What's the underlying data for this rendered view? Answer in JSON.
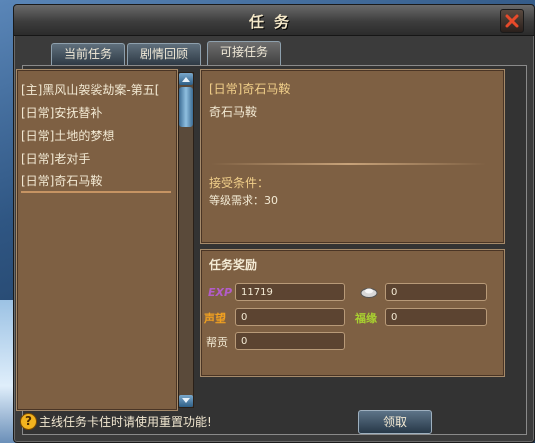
{
  "window": {
    "title": "任务"
  },
  "tabs": [
    {
      "label": "当前任务"
    },
    {
      "label": "剧情回顾"
    },
    {
      "label": "可接任务"
    }
  ],
  "quest_list": [
    {
      "label": "[主]黑风山袈裟劫案-第五["
    },
    {
      "label": "[日常]安抚替补"
    },
    {
      "label": "[日常]土地的梦想"
    },
    {
      "label": "[日常]老对手"
    },
    {
      "label": "[日常]奇石马鞍"
    }
  ],
  "detail": {
    "title": "[日常]奇石马鞍",
    "description": "奇石马鞍",
    "accept_header": "接受条件：",
    "requirement": "等级需求：30"
  },
  "rewards": {
    "header": "任务奖励",
    "exp_label": "EXP",
    "exp_value": "11719",
    "silver_value": "0",
    "prestige_label": "声望",
    "prestige_value": "0",
    "fortune_label": "福缘",
    "fortune_value": "0",
    "contribution_label": "帮贡",
    "contribution_value": "0"
  },
  "footer": {
    "hint": "主线任务卡住时请使用重置功能!",
    "claim_label": "领取"
  },
  "colors": {
    "panel_brown": "#7e6043",
    "gold_text": "#f1cf8a",
    "exp_purple": "#b35cc8",
    "prestige_orange": "#f0a020",
    "fortune_green": "#a8d030"
  }
}
